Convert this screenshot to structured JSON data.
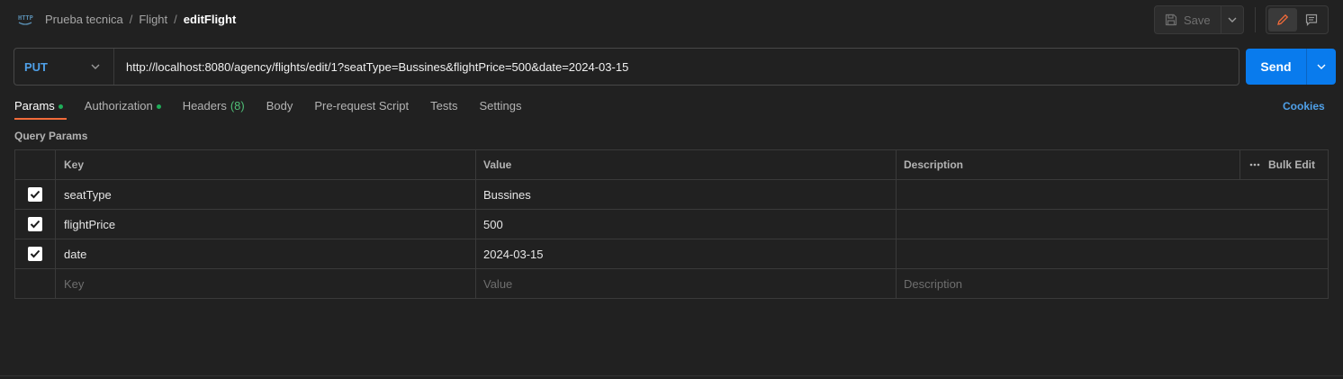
{
  "breadcrumb": {
    "collection": "Prueba tecnica",
    "folder": "Flight",
    "request": "editFlight",
    "separator": "/"
  },
  "toolbar": {
    "save_label": "Save"
  },
  "request": {
    "method": "PUT",
    "url": "http://localhost:8080/agency/flights/edit/1?seatType=Bussines&flightPrice=500&date=2024-03-15",
    "send_label": "Send"
  },
  "tabs": [
    {
      "label": "Params",
      "active": true,
      "dot": true
    },
    {
      "label": "Authorization",
      "dot": true
    },
    {
      "label": "Headers",
      "count": "(8)"
    },
    {
      "label": "Body"
    },
    {
      "label": "Pre-request Script"
    },
    {
      "label": "Tests"
    },
    {
      "label": "Settings"
    }
  ],
  "cookies_label": "Cookies",
  "params": {
    "section_label": "Query Params",
    "headers": {
      "key": "Key",
      "value": "Value",
      "description": "Description",
      "bulk_edit": "Bulk Edit"
    },
    "rows": [
      {
        "key": "seatType",
        "value": "Bussines",
        "checked": true
      },
      {
        "key": "flightPrice",
        "value": "500",
        "checked": true
      },
      {
        "key": "date",
        "value": "2024-03-15",
        "checked": true
      }
    ],
    "placeholders": {
      "key": "Key",
      "value": "Value",
      "description": "Description"
    }
  },
  "colors": {
    "accent_blue": "#097bed",
    "method_blue": "#4fa0e8",
    "active_tab_underline": "#f26b3a",
    "status_dot": "#1fad59"
  },
  "icons": {
    "http": "http-icon",
    "save": "save-icon",
    "edit": "pencil-icon",
    "comments": "comment-icon"
  }
}
